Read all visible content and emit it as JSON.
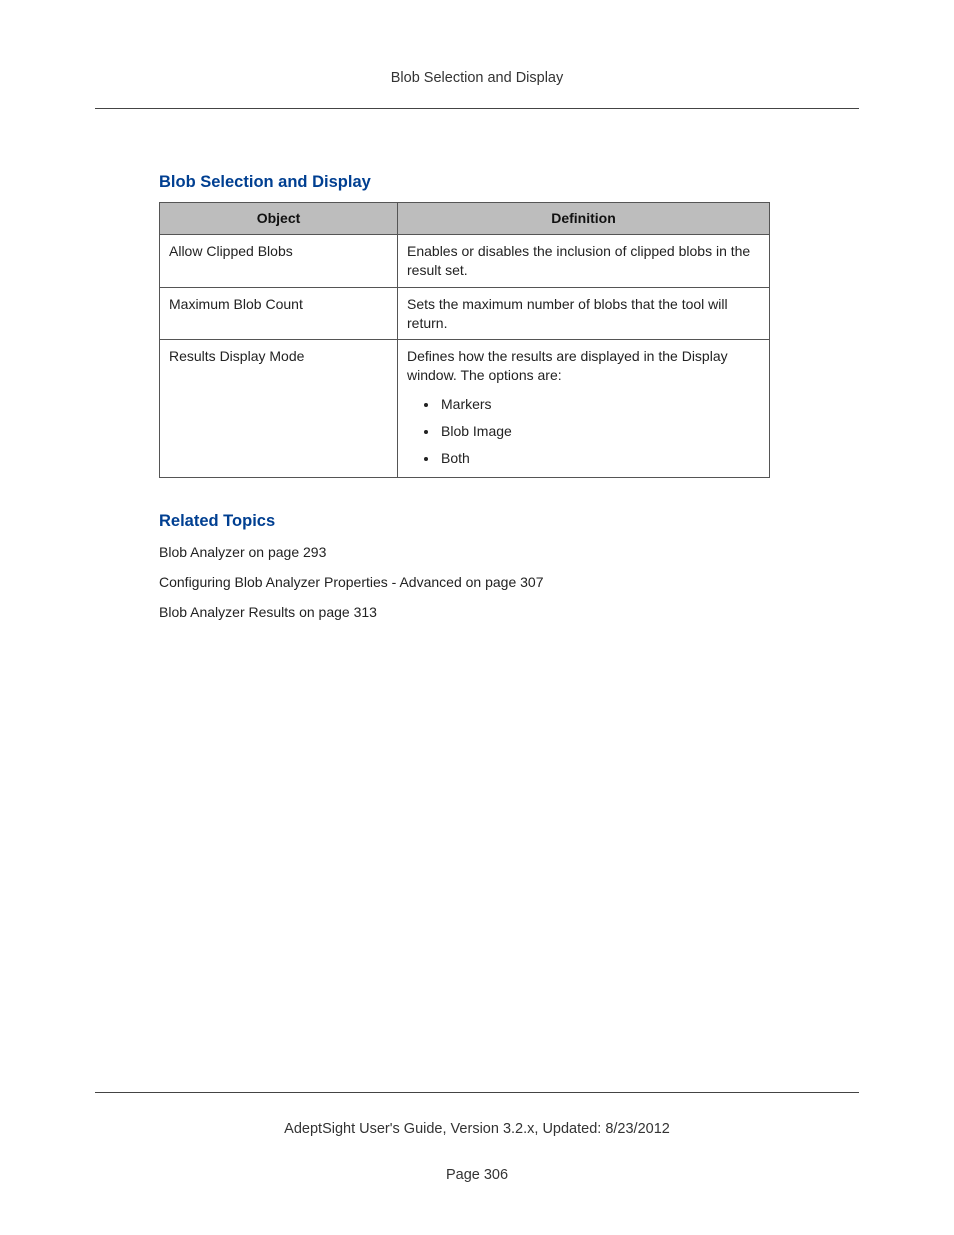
{
  "header": {
    "title": "Blob Selection and Display"
  },
  "section": {
    "heading": "Blob Selection and Display"
  },
  "table": {
    "headers": {
      "object": "Object",
      "definition": "Definition"
    },
    "rows": [
      {
        "object": "Allow Clipped Blobs",
        "definition": "Enables or disables the inclusion of clipped blobs in the result set."
      },
      {
        "object": "Maximum Blob Count",
        "definition": "Sets the maximum number of blobs that the tool will return."
      },
      {
        "object": "Results Display Mode",
        "definition_lead": "Defines how the results are displayed in the Display window. The options are:",
        "options": [
          "Markers",
          "Blob Image",
          "Both"
        ]
      }
    ]
  },
  "related": {
    "heading": "Related Topics",
    "items": [
      "Blob Analyzer on page 293",
      "Configuring Blob Analyzer Properties - Advanced on page 307",
      "Blob Analyzer Results on page 313"
    ]
  },
  "footer": {
    "text": "AdeptSight User's Guide,  Version 3.2.x, Updated: 8/23/2012",
    "page": "Page 306"
  }
}
